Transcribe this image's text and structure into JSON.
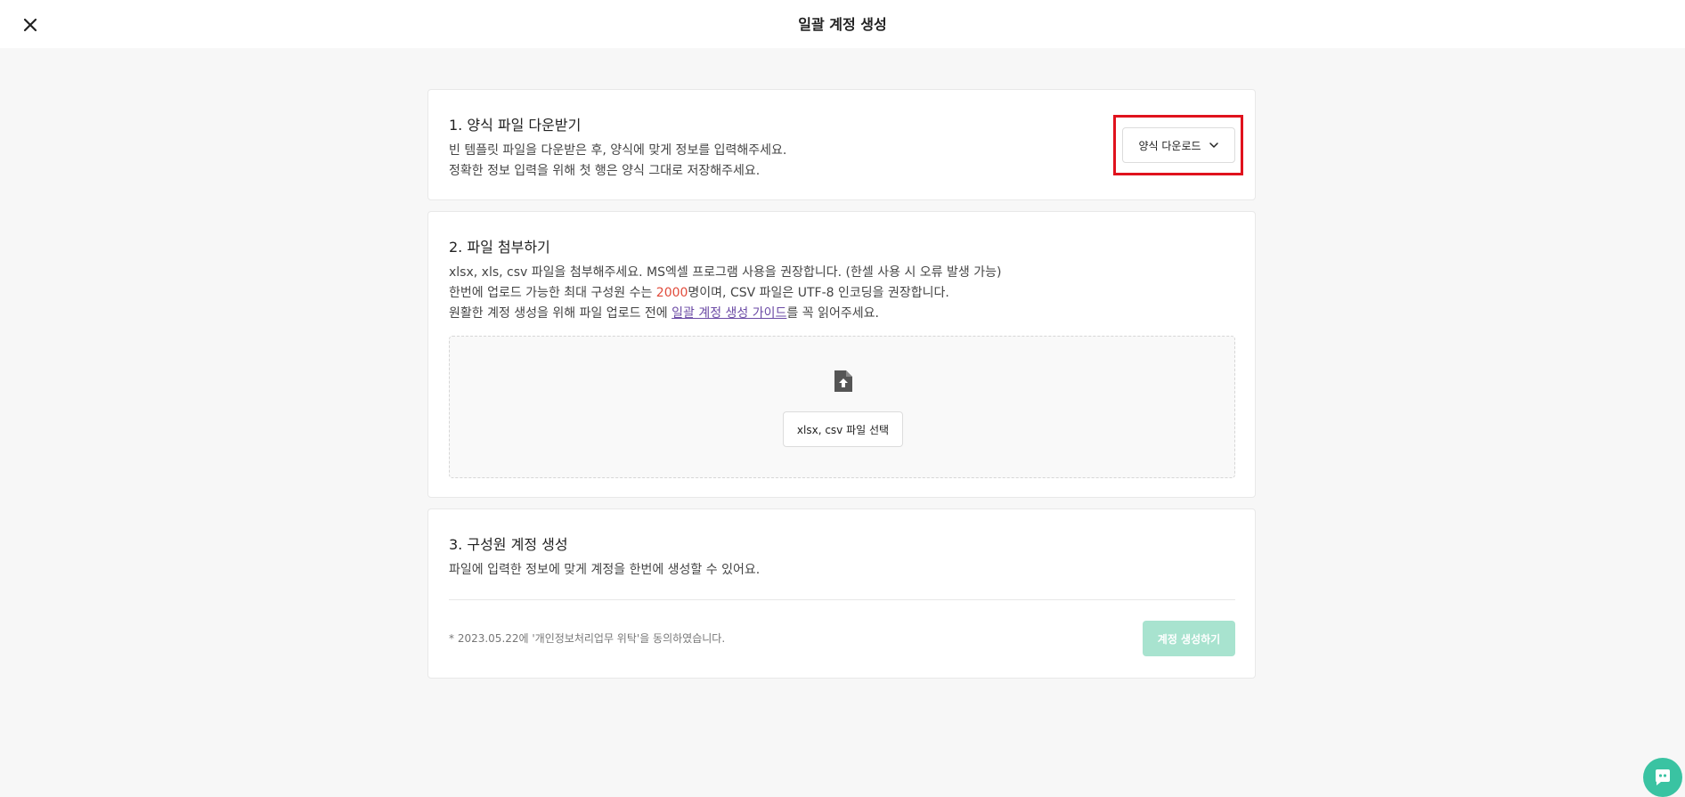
{
  "header": {
    "title": "일괄 계정 생성",
    "close_icon": "close-icon"
  },
  "step1": {
    "title": "1. 양식 파일 다운받기",
    "desc_line1": "빈 템플릿 파일을 다운받은 후, 양식에 맞게 정보를 입력해주세요.",
    "desc_line2": "정확한 정보 입력을 위해 첫 행은 양식 그대로 저장해주세요.",
    "download_button": "양식 다운로드",
    "download_icon": "chevron-down-icon"
  },
  "step2": {
    "title": "2. 파일 첨부하기",
    "desc_line1": "xlsx, xls, csv 파일을 첨부해주세요. MS엑셀 프로그램 사용을 권장합니다. (한셀 사용 시 오류 발생 가능)",
    "desc_line2_prefix": "한번에 업로드 가능한 최대 구성원 수는 ",
    "desc_line2_limit": "2000",
    "desc_line2_suffix": "명이며, CSV 파일은 UTF-8 인코딩을 권장합니다.",
    "desc_line3_prefix": "원활한 계정 생성을 위해 파일 업로드 전에 ",
    "desc_line3_link": "일괄 계정 생성 가이드",
    "desc_line3_suffix": "를 꼭 읽어주세요.",
    "upload_icon": "file-upload-icon",
    "file_select_button": "xlsx, csv 파일 선택"
  },
  "step3": {
    "title": "3. 구성원 계정 생성",
    "desc": "파일에 입력한 정보에 맞게 계정을 한번에 생성할 수 있어요.",
    "consent_note": "* 2023.05.22에 '개인정보처리업무 위탁'을 동의하였습니다.",
    "create_button": "계정 생성하기"
  },
  "chat": {
    "icon": "chat-icon"
  },
  "colors": {
    "accent_red": "#e14b3b",
    "primary_disabled": "#a8e3cf",
    "chat": "#3ac3a2",
    "highlight": "#e0121d"
  }
}
